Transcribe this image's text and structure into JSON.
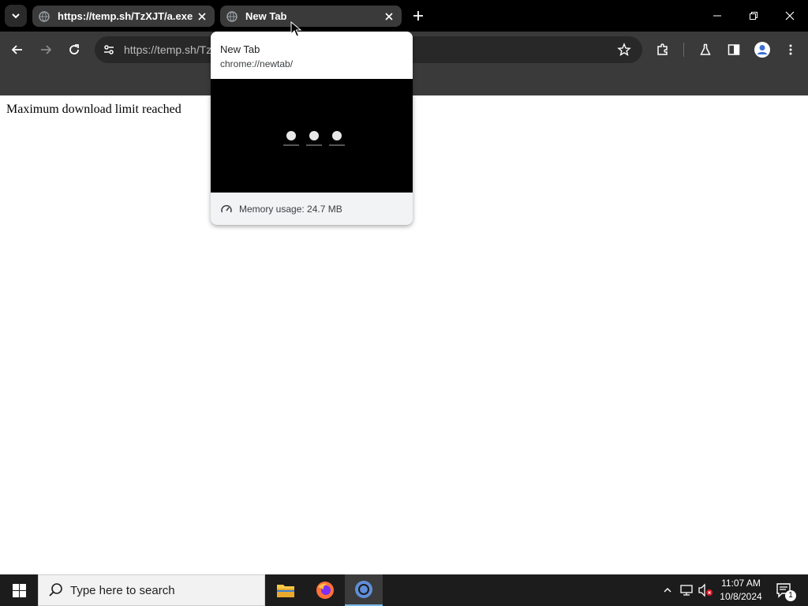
{
  "browser": {
    "tabs": [
      {
        "title": "https://temp.sh/TzXJT/a.exe",
        "active": false
      },
      {
        "title": "New Tab",
        "active": true
      }
    ],
    "omnibox": {
      "url_text": "https://temp.sh/Tz"
    }
  },
  "page": {
    "message": "Maximum download limit reached"
  },
  "hover_card": {
    "title": "New Tab",
    "url": "chrome://newtab/",
    "memory": "Memory usage: 24.7 MB"
  },
  "taskbar": {
    "search_placeholder": "Type here to search",
    "time": "11:07 AM",
    "date": "10/8/2024",
    "notification_count": "1"
  },
  "colors": {
    "tabstrip": "#000000",
    "toolbar": "#3a3a3a",
    "taskbar": "#1c1c1c",
    "active_task_underline": "#76b9ed"
  }
}
